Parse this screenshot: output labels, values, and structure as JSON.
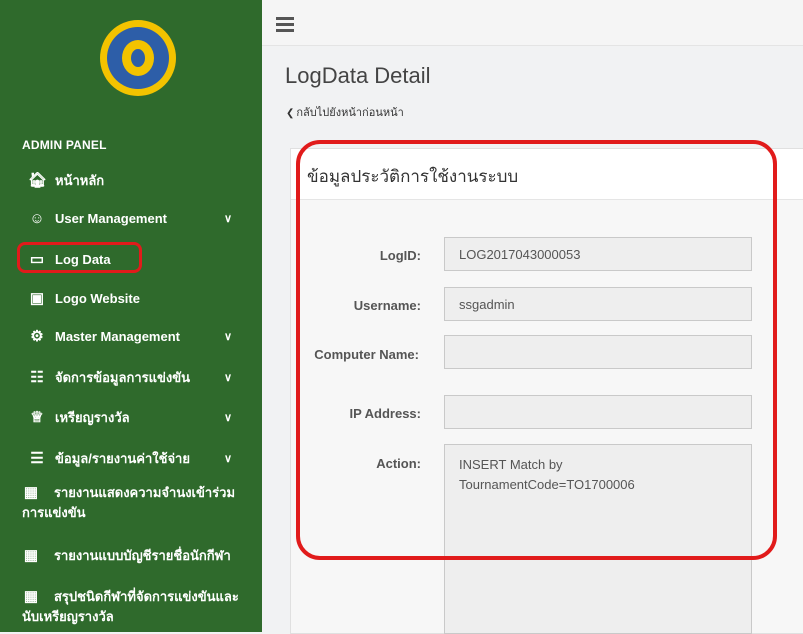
{
  "sidebar": {
    "panel_title": "ADMIN PANEL",
    "items": [
      {
        "label": "หน้าหลัก",
        "icon": "home-icon"
      },
      {
        "label": "User Management",
        "icon": "users-icon",
        "has_submenu": true
      },
      {
        "label": "Log Data",
        "icon": "hdd-icon"
      },
      {
        "label": "Logo Website",
        "icon": "picture-icon"
      },
      {
        "label": "Master Management",
        "icon": "cogs-icon",
        "has_submenu": true
      },
      {
        "label": "จัดการข้อมูลการแข่งขัน",
        "icon": "sitemap-icon",
        "has_submenu": true
      },
      {
        "label": "เหรียญรางวัล",
        "icon": "trophy-icon",
        "has_submenu": true
      },
      {
        "label": "ข้อมูล/รายงานค่าใช้จ่าย",
        "icon": "file-icon",
        "has_submenu": true
      },
      {
        "label": "รายงานแสดงความจำนงเข้าร่วมการแข่งขัน",
        "icon": "table-icon"
      },
      {
        "label": "รายงานแบบบัญชีรายชื่อนักกีฬา",
        "icon": "table-icon"
      },
      {
        "label": "สรุปชนิดกีฬาที่จัดการแข่งขันและนับเหรียญรางวัล",
        "icon": "table-icon"
      }
    ]
  },
  "page": {
    "title": "LogData Detail",
    "back_label": "กลับไปยังหน้าก่อนหน้า"
  },
  "card": {
    "title": "ข้อมูลประวัติการใช้งานระบบ"
  },
  "form": {
    "logid_label": "LogID:",
    "logid_value": "LOG2017043000053",
    "username_label": "Username:",
    "username_value": "ssgadmin",
    "computer_label": "Computer Name:",
    "computer_value": "",
    "ip_label": "IP Address:",
    "ip_value": "",
    "action_label": "Action:",
    "action_value": "INSERT Match by TournamentCode=TO1700006"
  },
  "colors": {
    "sidebar_bg": "#2f6a2c",
    "annotation": "#e11b1b"
  }
}
